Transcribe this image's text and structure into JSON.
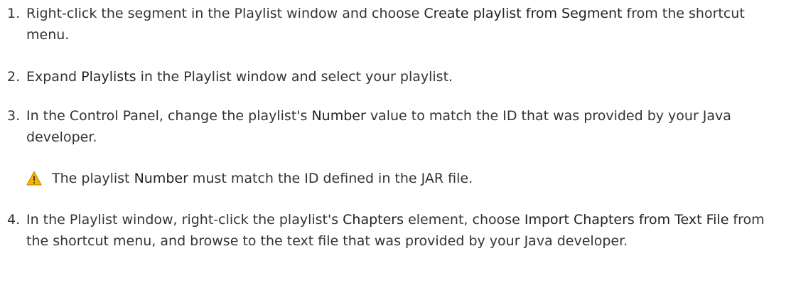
{
  "steps": [
    {
      "number": "1.",
      "parts": [
        "Right-click the segment in the Playlist window and choose ",
        "Create playlist from Segment",
        " from the shortcut menu."
      ]
    },
    {
      "number": "2.",
      "parts": [
        "Expand ",
        "Playlists",
        " in the Playlist window and select your playlist."
      ]
    },
    {
      "number": "3.",
      "parts": [
        "In the Control Panel, change the playlist's ",
        "Number",
        " value to match the ID that was provided by your Java developer."
      ]
    },
    {
      "number": "4.",
      "parts": [
        "In the Playlist window, right-click the playlist's ",
        "Chapters",
        " element, choose ",
        "Import Chapters from Text File",
        " from the shortcut menu, and browse to the text file that was provided by your Java developer."
      ]
    }
  ],
  "note": {
    "icon": "warning-icon",
    "parts": [
      "The playlist ",
      "Number",
      " must match the ID defined in the JAR file."
    ]
  },
  "colors": {
    "text": "#333333",
    "warning_fill": "#F5B800",
    "warning_stroke": "#C98A00"
  }
}
